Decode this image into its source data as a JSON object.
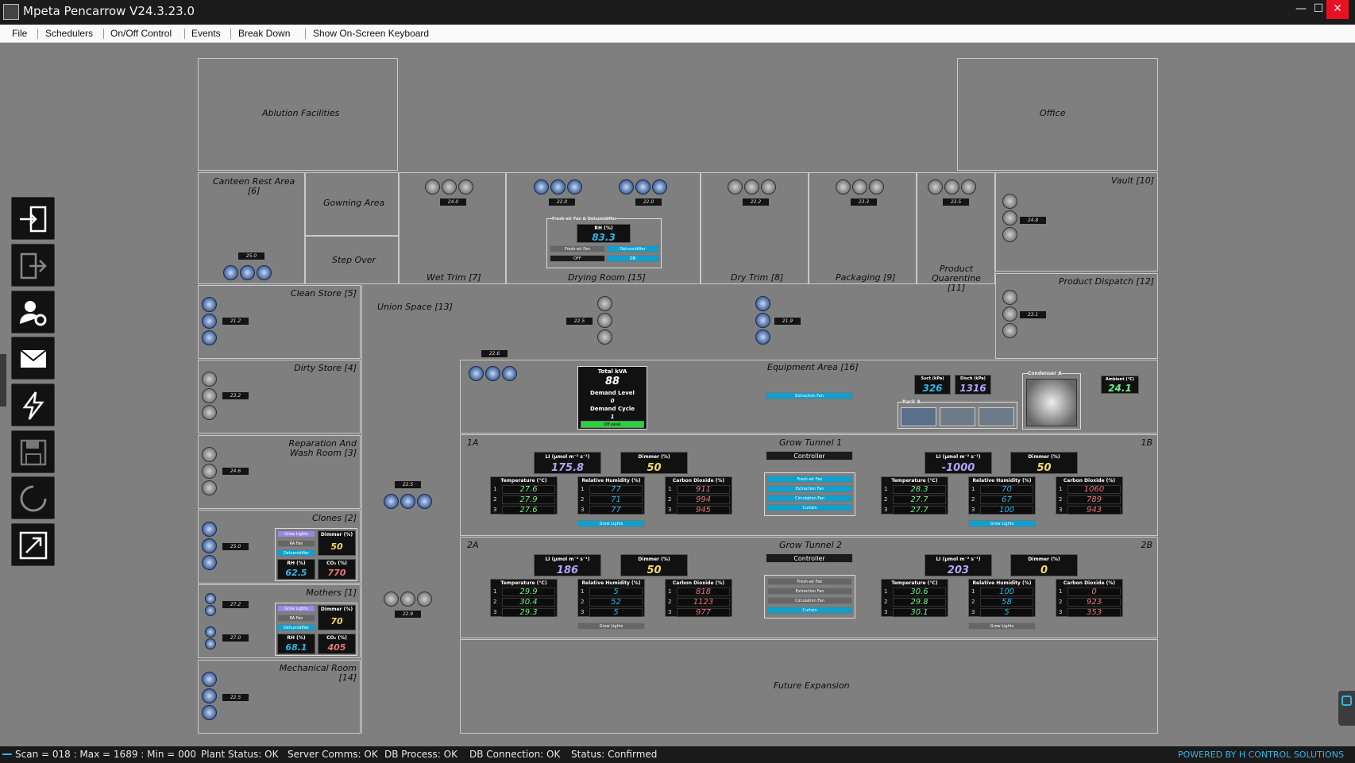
{
  "window": {
    "title": "Mpeta Pencarrow V24.3.23.0",
    "minimize": "—",
    "maximize": "☐",
    "close": "✕"
  },
  "menu": {
    "file": "File",
    "schedulers": "Schedulers",
    "onoff": "On/Off Control",
    "events": "Events",
    "breakdown": "Break Down",
    "keyboard": "Show On-Screen Keyboard"
  },
  "rooms": {
    "ablution": "Ablution Facilities",
    "office": "Office",
    "canteen": "Canteen Rest Area\n[6]",
    "gowning": "Gowning Area",
    "stepover": "Step Over",
    "wettrim": "Wet Trim [7]",
    "drying": "Drying Room [15]",
    "drytrim": "Dry Trim [8]",
    "packaging": "Packaging [9]",
    "quarantine": "Product\nQuarentine [11]",
    "vault": "Vault [10]",
    "dispatch": "Product Dispatch [12]",
    "cleanstore": "Clean Store [5]",
    "union": "Union Space [13]",
    "dirtystore": "Dirty Store [4]",
    "equipment": "Equipment Area [16]",
    "reparation": "Reparation And\nWash Room [3]",
    "clones": "Clones [2]",
    "mothers": "Mothers [1]",
    "mechanical": "Mechanical Room\n[14]",
    "grow1": "Grow Tunnel 1",
    "grow2": "Grow Tunnel 2",
    "future": "Future Expansion",
    "t1a": "1A",
    "t1b": "1B",
    "t2a": "2A",
    "t2b": "2B"
  },
  "temps": {
    "canteen": "25.0",
    "wettrim": "24.0",
    "drying1": "22.0",
    "drying2": "22.0",
    "drytrim": "22.2",
    "packaging": "23.3",
    "quarantine": "23.5",
    "vault": "24.8",
    "dispatch": "23.1",
    "cleanstore": "21.2",
    "union1": "22.5",
    "union2": "21.9",
    "union3": "22.6",
    "dirtystore": "23.2",
    "reparation": "24.6",
    "clones": "25.0",
    "union4": "22.5",
    "mothers1": "27.2",
    "mothers2": "27.0",
    "union5": "22.9",
    "mechanical": "22.5"
  },
  "drying_panel": {
    "title": "Fresh-air Fan & Dehumidifier",
    "rh_label": "RH (%)",
    "rh": "83.3",
    "freshair": "Fresh-air Fan",
    "dehum": "Dehumidifier",
    "off": "OFF",
    "on": "ON"
  },
  "kva": {
    "title": "Total kVA",
    "value": "88",
    "demand_level_label": "Demand Level",
    "demand_level": "0",
    "demand_cycle_label": "Demand Cycle",
    "demand_cycle": "1",
    "state": "Off-peak"
  },
  "equipment": {
    "extraction": "Extraction Fan",
    "suct_label": "Suct (kPa)",
    "suct": "326",
    "disch_label": "Disch (kPa)",
    "disch": "1316",
    "condenser": "Condenser A",
    "ambient_label": "Ambient (°C)",
    "ambient": "24.1",
    "rack": "Rack A"
  },
  "clones_panel": {
    "grow": "Grow Lights",
    "ra": "RA Fan",
    "dehum": "Dehumidifier",
    "dimmer_label": "Dimmer (%)",
    "dimmer": "50",
    "rh_label": "RH (%)",
    "rh": "62.5",
    "co2_label": "CO₂ (%)",
    "co2": "770"
  },
  "mothers_panel": {
    "grow": "Grow Lights",
    "ra": "RA Fan",
    "dehum": "Dehumidifier",
    "dimmer_label": "Dimmer (%)",
    "dimmer": "70",
    "rh_label": "RH (%)",
    "rh": "68.1",
    "co2_label": "CO₂ (%)",
    "co2": "405"
  },
  "labels": {
    "li": "LI (μmol m⁻² s⁻¹)",
    "dimmer": "Dimmer (%)",
    "temp": "Temperature (°C)",
    "rh": "Relative Humidity (%)",
    "co2": "Carbon Dioxide (%)",
    "grow": "Grow Lights",
    "controller": "Controller",
    "freshair": "Fresh-air Fan",
    "extraction": "Extraction Fan",
    "circulation": "Circulation Fan",
    "curtain": "Curtain",
    "n1": "1",
    "n2": "2",
    "n3": "3"
  },
  "t1a": {
    "li": "175.8",
    "dimmer": "50",
    "temp": [
      "27.6",
      "27.9",
      "27.6"
    ],
    "rh": [
      "77",
      "71",
      "77"
    ],
    "co2": [
      "911",
      "994",
      "945"
    ]
  },
  "t1b": {
    "li": "-1000",
    "dimmer": "50",
    "temp": [
      "28.3",
      "27.7",
      "27.7"
    ],
    "rh": [
      "70",
      "67",
      "100"
    ],
    "co2": [
      "1060",
      "789",
      "943"
    ]
  },
  "t2a": {
    "li": "186",
    "dimmer": "50",
    "temp": [
      "29.9",
      "30.4",
      "29.3"
    ],
    "rh": [
      "5",
      "52",
      "5"
    ],
    "co2": [
      "818",
      "1123",
      "977"
    ]
  },
  "t2b": {
    "li": "203",
    "dimmer": "0",
    "temp": [
      "30.6",
      "29.8",
      "30.1"
    ],
    "rh": [
      "100",
      "58",
      "5"
    ],
    "co2": [
      "0",
      "923",
      "353"
    ]
  },
  "status": {
    "scan": "Scan = 018 : Max = 1689 : Min = 000",
    "plant": "Plant Status: OK",
    "server": "Server Comms: OK",
    "dbproc": "DB Process:  OK",
    "dbconn": "DB Connection:  OK",
    "status": "Status:  Confirmed",
    "powered": "POWERED BY H CONTROL SOLUTIONS"
  }
}
